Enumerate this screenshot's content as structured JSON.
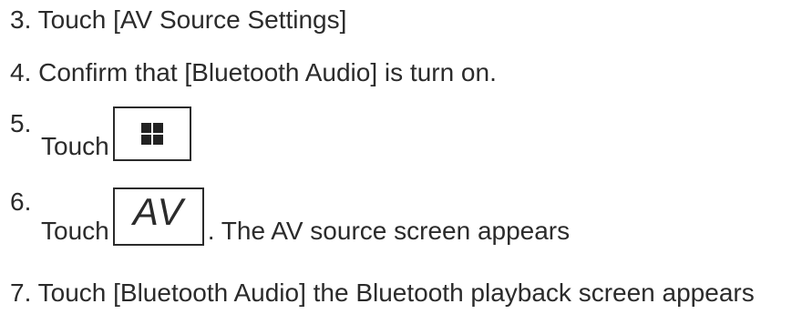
{
  "steps": {
    "s3": {
      "text": "3. Touch [AV Source Settings]"
    },
    "s4": {
      "text": "4. Confirm that [Bluetooth Audio] is turn on."
    },
    "s5": {
      "number": "5.",
      "touch": "Touch",
      "icon": "grid-menu-icon"
    },
    "s6": {
      "number": "6.",
      "touch": "Touch",
      "icon_label": "AV",
      "after": ". The AV source screen appears"
    },
    "s7": {
      "text": "7. Touch [Bluetooth Audio] the Bluetooth playback screen appears"
    }
  }
}
